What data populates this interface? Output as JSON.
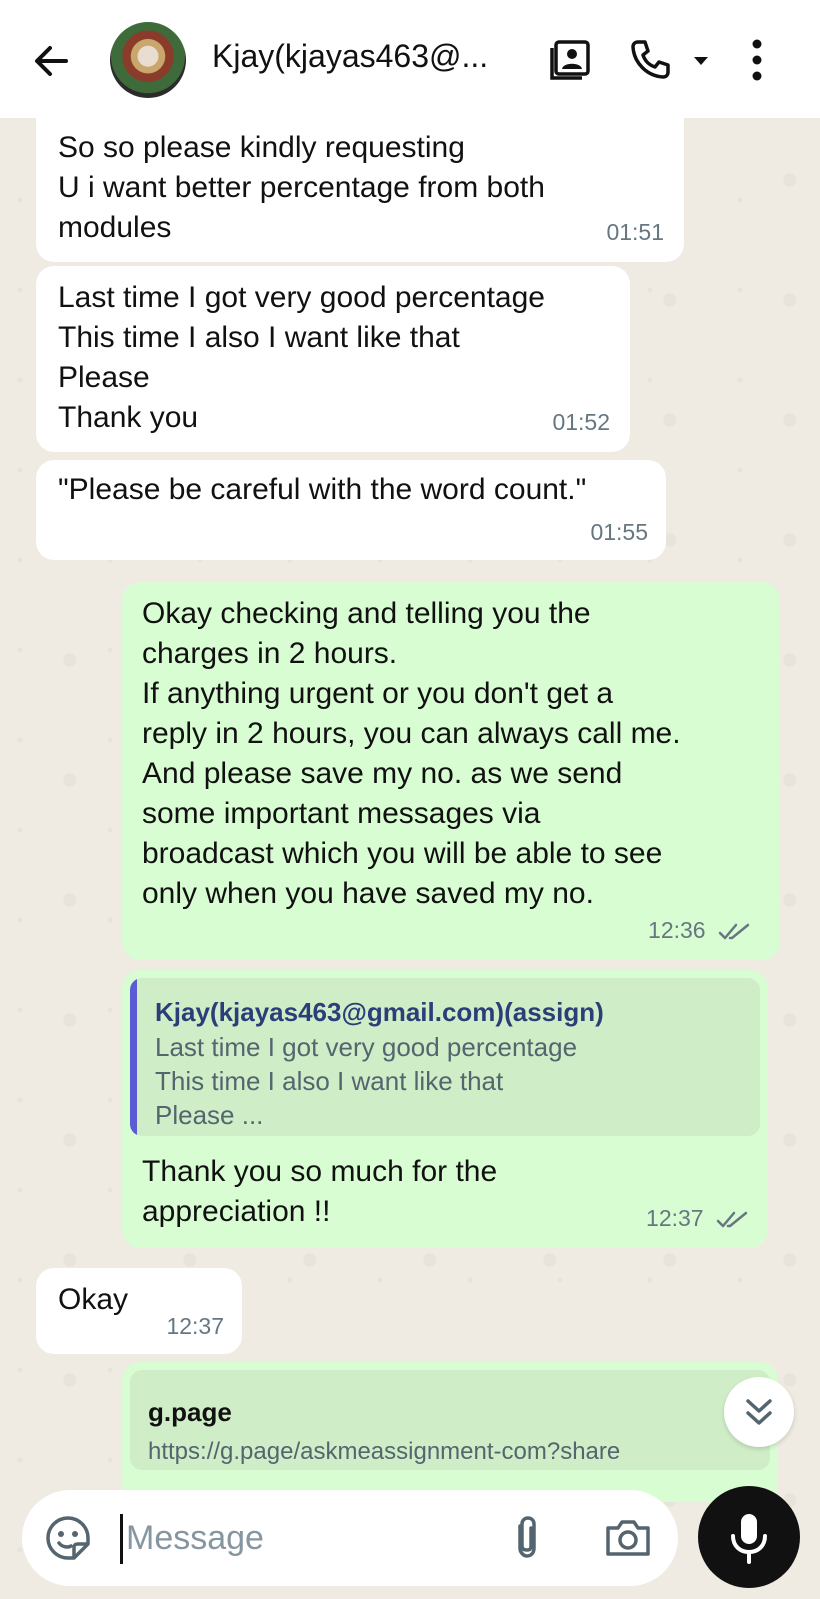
{
  "header": {
    "contact_name": "Kjay(kjayas463@...",
    "icons": [
      "back-arrow-icon",
      "contact-card-icon",
      "phone-icon",
      "dropdown-caret-icon",
      "more-vert-icon"
    ]
  },
  "messages": [
    {
      "direction": "incoming",
      "text": "So so please kindly requesting\nU i want better percentage from both\nmodules",
      "time": "01:51"
    },
    {
      "direction": "incoming",
      "text": "Last time I got very good percentage\nThis time I also I want like that\nPlease\nThank you",
      "time": "01:52"
    },
    {
      "direction": "incoming",
      "text": "\"Please be careful with the word count.\"",
      "time": "01:55"
    },
    {
      "direction": "outgoing",
      "text": "Okay checking and telling you the\ncharges in 2 hours.\nIf anything urgent or you don't get a\nreply in 2 hours, you can always call me.\nAnd please save my no. as we send\nsome important messages via\nbroadcast which you will be able to see\nonly when you have saved my no.",
      "time": "12:36",
      "status": "read-ticks-icon"
    },
    {
      "direction": "outgoing",
      "quote_author": "Kjay(kjayas463@gmail.com)(assign)",
      "quote_text": "Last time I got very good percentage\nThis time I also I want like that\nPlease ...",
      "text": "Thank you so much for the\nappreciation !!",
      "time": "12:37",
      "status": "read-ticks-icon"
    },
    {
      "direction": "incoming",
      "text": "Okay",
      "time": "12:37"
    },
    {
      "direction": "outgoing",
      "link_domain": "g.page",
      "link_url": "https://g.page/askmeassignment-com?share"
    }
  ],
  "composer": {
    "placeholder": "Message",
    "icons": [
      "emoji-sticker-icon",
      "paperclip-icon",
      "camera-icon",
      "microphone-icon"
    ]
  },
  "scroll_button_icon": "double-chevron-down-icon",
  "colors": {
    "incoming_bubble": "#ffffff",
    "outgoing_bubble": "#d9fdd3",
    "chat_background": "#efeae2",
    "quote_bar": "#5b5bd6",
    "mic_button": "#111111",
    "timestamp": "#667781"
  }
}
